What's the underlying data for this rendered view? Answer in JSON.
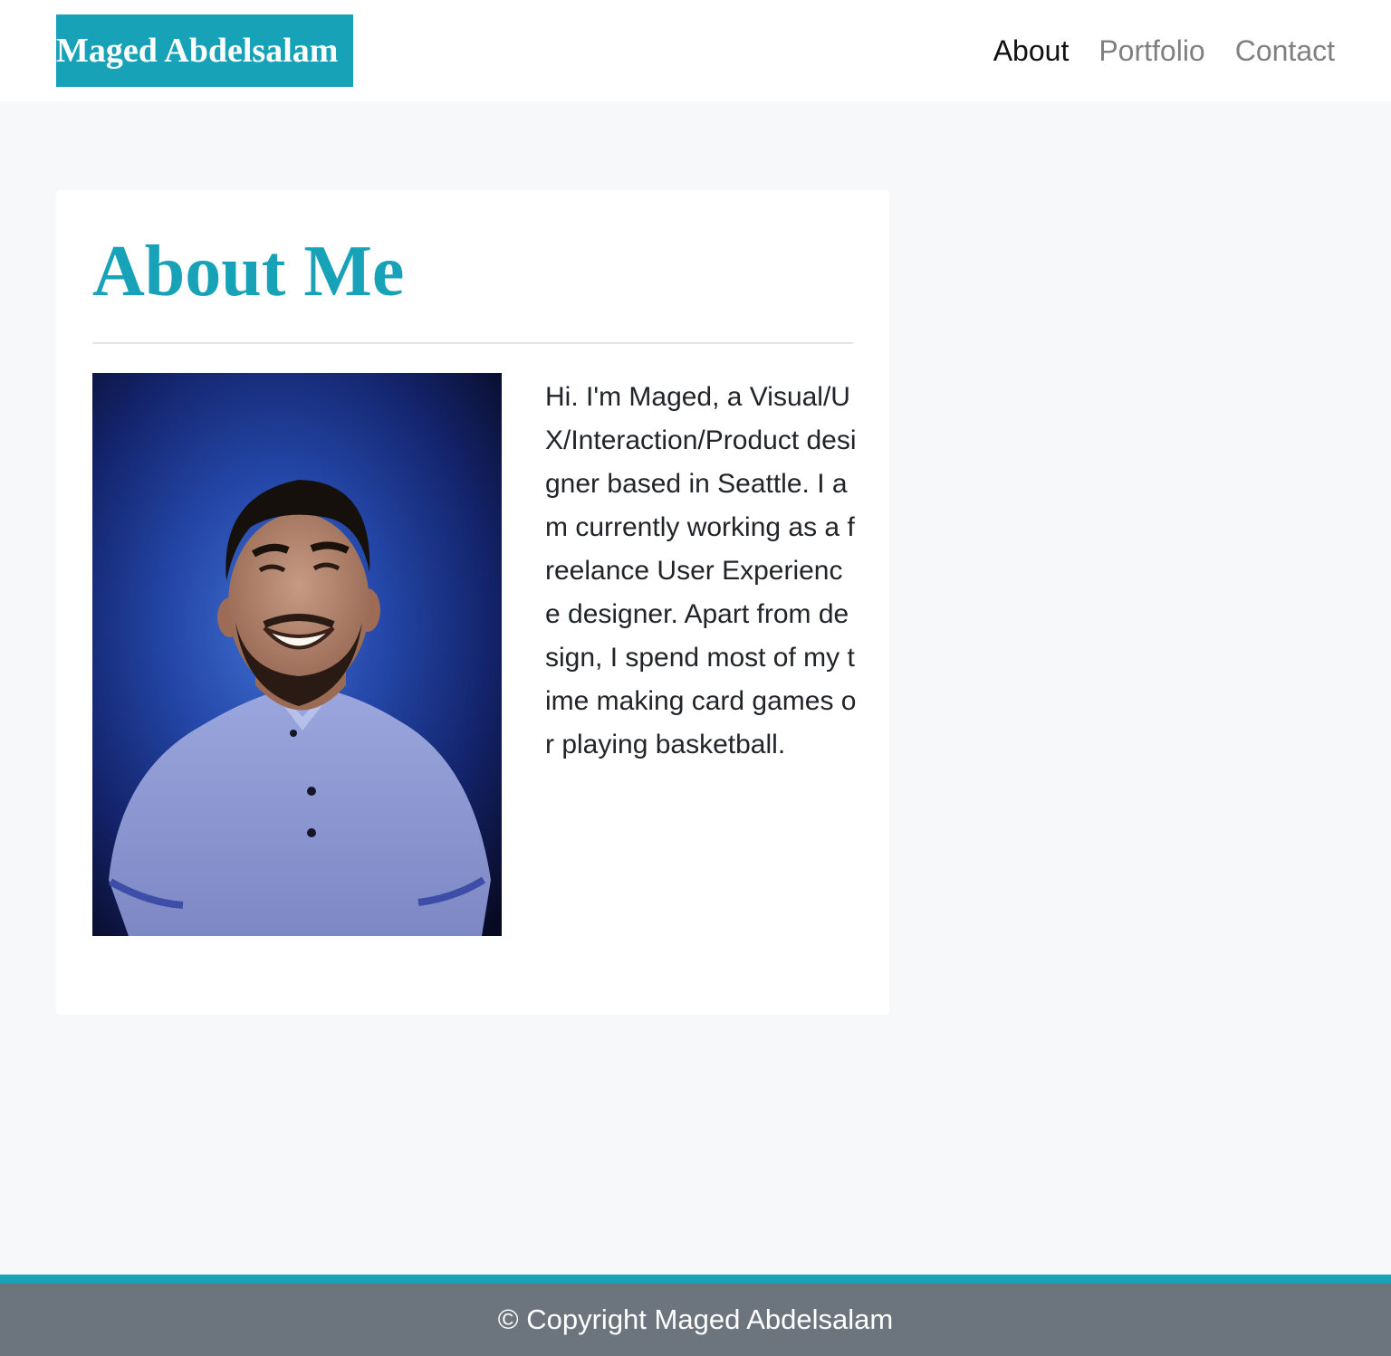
{
  "navbar": {
    "brand": "Maged Abdelsalam",
    "links": [
      {
        "label": "About",
        "active": true
      },
      {
        "label": "Portfolio",
        "active": false
      },
      {
        "label": "Contact",
        "active": false
      }
    ]
  },
  "about": {
    "title": "About Me",
    "photo": {
      "subject": "portrait-photo",
      "alt": "Photo of Maged"
    },
    "bio": "Hi. I'm Maged, a Visual/UX/Interaction/Product designer based in Seattle. I am currently working as a freelance User Experience designer. Apart from design, I spend most of my time making card games or playing basketball."
  },
  "footer": {
    "copyright": "© Copyright Maged Abdelsalam"
  },
  "colors": {
    "accent": "#17a2b8",
    "page_background": "#f7f8fa",
    "footer_background": "#6c757d",
    "nav_active": "#111111",
    "nav_inactive": "#808080"
  }
}
